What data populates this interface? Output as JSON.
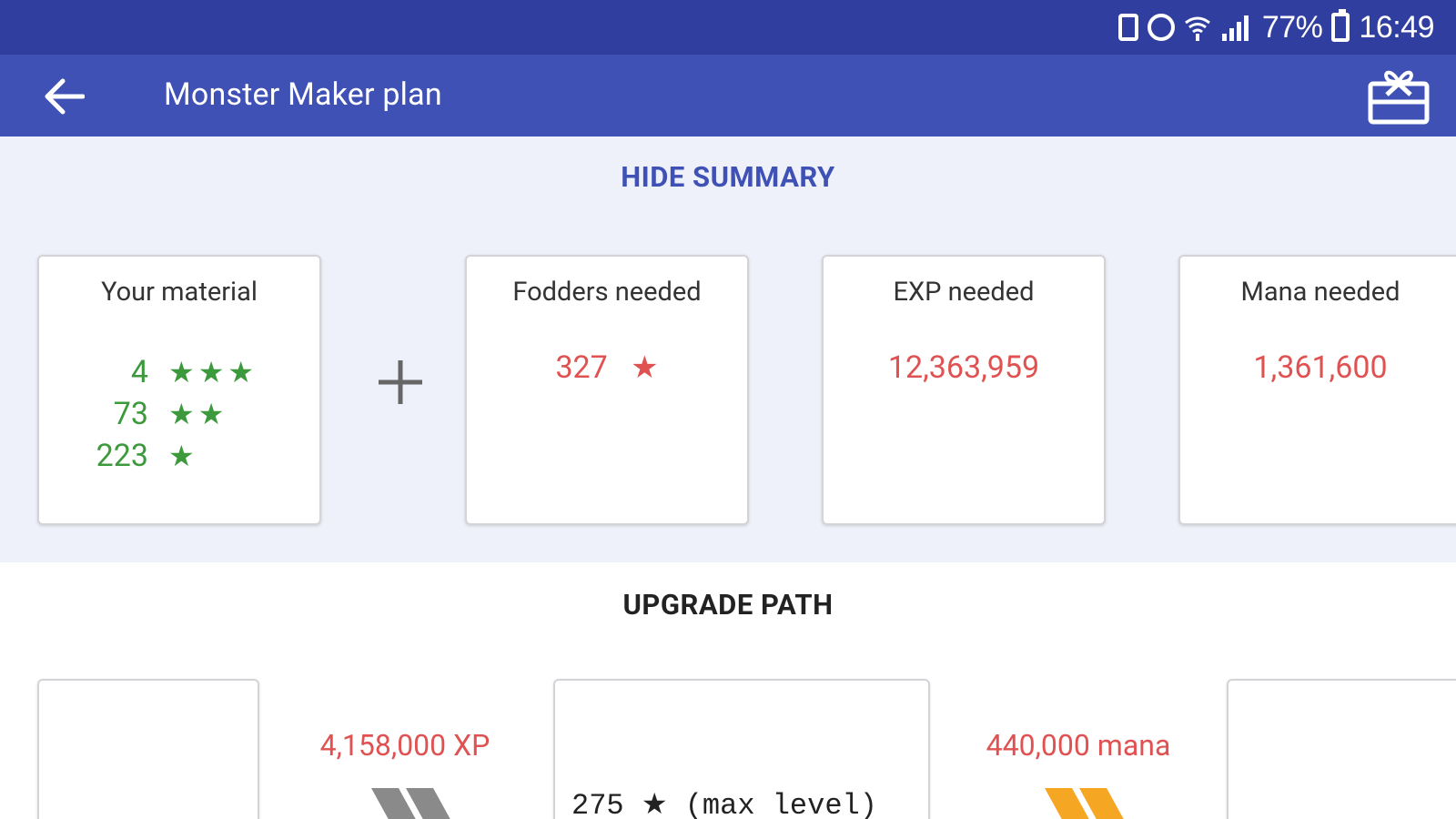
{
  "status_bar": {
    "battery": "77%",
    "time": "16:49",
    "icons": [
      "sim-icon",
      "alarm-icon",
      "wifi-icon",
      "signal-icon",
      "battery-icon"
    ]
  },
  "app_bar": {
    "title": "Monster Maker plan",
    "back_icon": "arrow-left-icon",
    "action_icon": "gift-icon"
  },
  "summary": {
    "toggle_label": "HIDE SUMMARY",
    "material": {
      "title": "Your material",
      "rows": [
        {
          "count": "4",
          "stars": "★★★"
        },
        {
          "count": "73",
          "stars": "★★"
        },
        {
          "count": "223",
          "stars": "★"
        }
      ]
    },
    "fodders": {
      "title": "Fodders needed",
      "value": "327",
      "star": "★"
    },
    "exp": {
      "title": "EXP needed",
      "value": "12,363,959"
    },
    "mana": {
      "title": "Mana needed",
      "value": "1,361,600"
    }
  },
  "upgrade_path": {
    "title": "UPGRADE PATH",
    "xp_label": "4,158,000 XP",
    "mana_label": "440,000 mana",
    "middle_card_text": "275 ★ (max level)"
  },
  "colors": {
    "status_bar": "#303f9f",
    "app_bar": "#3f51b5",
    "summary_bg": "#eef0fa",
    "accent_red": "#e05252",
    "accent_green": "#3c9a3c",
    "chevron_gray": "#8a8a8a",
    "chevron_orange": "#f5a623"
  }
}
